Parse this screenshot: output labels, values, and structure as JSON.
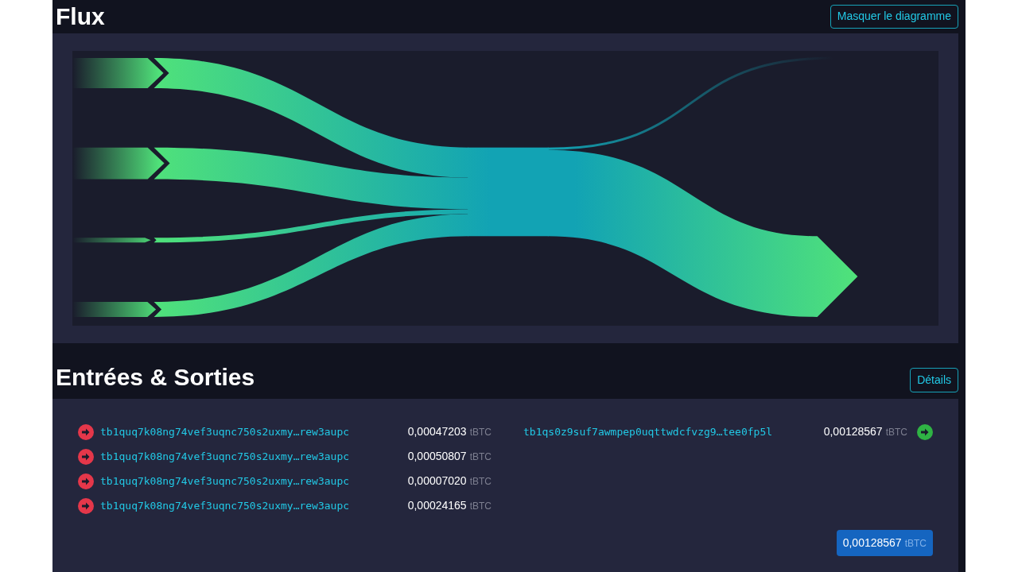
{
  "flux": {
    "title": "Flux",
    "toggle_button": "Masquer le diagramme"
  },
  "io": {
    "title": "Entrées & Sorties",
    "details_button": "Détails",
    "inputs": [
      {
        "address": "tb1quq7k08ng74vef3uqnc750s2uxmy…rew3aupc",
        "amount": "0,00047203",
        "unit": "tBTC"
      },
      {
        "address": "tb1quq7k08ng74vef3uqnc750s2uxmy…rew3aupc",
        "amount": "0,00050807",
        "unit": "tBTC"
      },
      {
        "address": "tb1quq7k08ng74vef3uqnc750s2uxmy…rew3aupc",
        "amount": "0,00007020",
        "unit": "tBTC"
      },
      {
        "address": "tb1quq7k08ng74vef3uqnc750s2uxmy…rew3aupc",
        "amount": "0,00024165",
        "unit": "tBTC"
      }
    ],
    "outputs": [
      {
        "address": "tb1qs0z9suf7awmpep0uqttwdcfvzg9…tee0fp5l",
        "amount": "0,00128567",
        "unit": "tBTC"
      }
    ],
    "total": {
      "amount": "0,00128567",
      "unit": "tBTC"
    }
  }
}
